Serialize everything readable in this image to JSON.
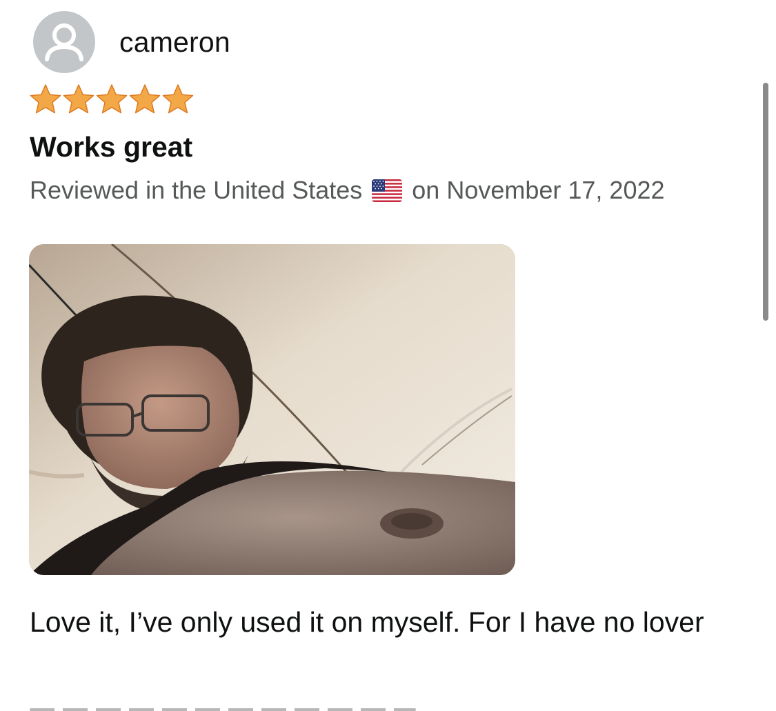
{
  "review": {
    "username": "cameron",
    "rating": 5,
    "rating_max": 5,
    "title": "Works great",
    "meta_before_flag": "Reviewed in the United States",
    "meta_after_flag": "on November 17, 2022",
    "body": "Love it, I’ve only used it on myself. For I have no lover"
  },
  "icons": {
    "avatar": "user-silhouette-icon",
    "star": "star-filled-icon",
    "flag": "us-flag-icon"
  },
  "colors": {
    "star": "#f3a847",
    "avatar_bg": "#c3c6c9",
    "meta_text": "#565959",
    "text": "#0f1111"
  }
}
